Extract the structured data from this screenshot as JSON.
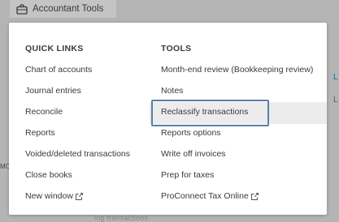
{
  "trigger": {
    "label": "Accountant Tools",
    "icon": "briefcase-icon"
  },
  "background": {
    "right_link_fragment": "L",
    "right_label_fragment": "L",
    "left_fragment": "MO",
    "bottom_fragment": "ing transactions"
  },
  "quick_links": {
    "heading": "QUICK LINKS",
    "items": [
      {
        "label": "Chart of accounts"
      },
      {
        "label": "Journal entries"
      },
      {
        "label": "Reconcile"
      },
      {
        "label": "Reports"
      },
      {
        "label": "Voided/deleted transactions"
      },
      {
        "label": "Close books"
      },
      {
        "label": "New window",
        "external": true
      }
    ]
  },
  "tools": {
    "heading": "TOOLS",
    "items": [
      {
        "label": "Month-end review (Bookkeeping review)"
      },
      {
        "label": "Notes"
      },
      {
        "label": "Reclassify transactions",
        "highlighted": true
      },
      {
        "label": "Reports options"
      },
      {
        "label": "Write off invoices"
      },
      {
        "label": "Prep for taxes"
      },
      {
        "label": "ProConnect Tax Online",
        "external": true
      }
    ]
  },
  "colors": {
    "overlay": "#b4b4b4",
    "text": "#393a3d",
    "focus_border": "#5c7fa8",
    "hover_row": "#ececec"
  }
}
